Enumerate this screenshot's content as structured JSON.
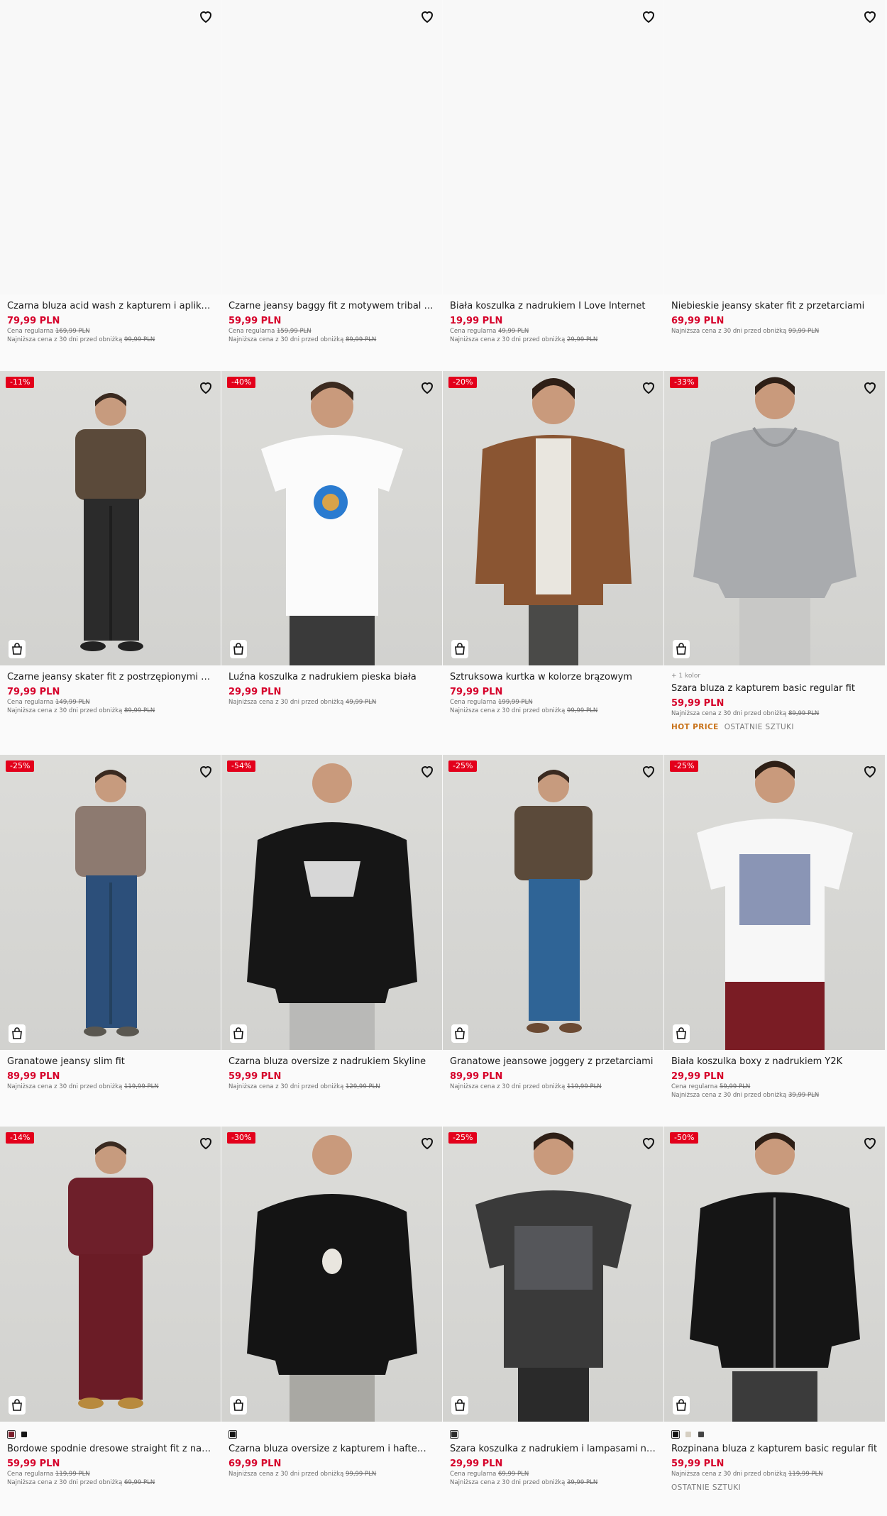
{
  "labels": {
    "regular": "Cena regularna",
    "lowest": "Najniższa cena z 30 dni przed obniżką"
  },
  "colors": {
    "price": "#d6002a",
    "badge": "#e3001b",
    "hot": "#c8721a"
  },
  "products": [
    {
      "title": "Czarna bluza acid wash z kapturem i aplikacjami",
      "price": "79,99 PLN",
      "regular": "169,99 PLN",
      "lowest": "99,99 PLN"
    },
    {
      "title": "Czarne jeansy baggy fit z motywem tribal na nogawkach",
      "price": "59,99 PLN",
      "regular": "159,99 PLN",
      "lowest": "89,99 PLN"
    },
    {
      "title": "Biała koszulka z nadrukiem I Love Internet",
      "price": "19,99 PLN",
      "regular": "49,99 PLN",
      "lowest": "29,99 PLN"
    },
    {
      "title": "Niebieskie jeansy skater fit z przetarciami",
      "price": "69,99 PLN",
      "lowest": "99,99 PLN"
    },
    {
      "badge": "-11%",
      "title": "Czarne jeansy skater fit z postrzępionymi brzegami",
      "price": "79,99 PLN",
      "regular": "149,99 PLN",
      "lowest": "89,99 PLN"
    },
    {
      "badge": "-40%",
      "title": "Luźna koszulka z nadrukiem pieska biała",
      "price": "29,99 PLN",
      "lowest": "49,99 PLN"
    },
    {
      "badge": "-20%",
      "title": "Sztruksowa kurtka w kolorze brązowym",
      "price": "79,99 PLN",
      "regular": "199,99 PLN",
      "lowest": "99,99 PLN"
    },
    {
      "badge": "-33%",
      "colors_count": "+ 1 kolor",
      "title": "Szara bluza z kapturem basic regular fit",
      "price": "59,99 PLN",
      "lowest": "89,99 PLN",
      "hot": "HOT PRICE",
      "last": "OSTATNIE SZTUKI"
    },
    {
      "badge": "-25%",
      "title": "Granatowe jeansy slim fit",
      "price": "89,99 PLN",
      "lowest": "119,99 PLN"
    },
    {
      "badge": "-54%",
      "title": "Czarna bluza oversize z nadrukiem Skyline",
      "price": "59,99 PLN",
      "lowest": "129,99 PLN"
    },
    {
      "badge": "-25%",
      "title": "Granatowe jeansowe joggery z przetarciami",
      "price": "89,99 PLN",
      "lowest": "119,99 PLN"
    },
    {
      "badge": "-25%",
      "title": "Biała koszulka boxy z nadrukiem Y2K",
      "price": "29,99 PLN",
      "regular": "59,99 PLN",
      "lowest": "39,99 PLN"
    },
    {
      "badge": "-14%",
      "title": "Bordowe spodnie dresowe straight fit z nadrukiem",
      "price": "59,99 PLN",
      "regular": "119,99 PLN",
      "lowest": "69,99 PLN"
    },
    {
      "badge": "-30%",
      "title": "Czarna bluza oversize z kapturem i haftem kaczki",
      "price": "69,99 PLN",
      "lowest": "99,99 PLN"
    },
    {
      "badge": "-25%",
      "title": "Szara koszulka z nadrukiem i lampasami na rękawach",
      "price": "29,99 PLN",
      "regular": "69,99 PLN",
      "lowest": "39,99 PLN"
    },
    {
      "badge": "-50%",
      "title": "Rozpinana bluza z kapturem basic regular fit",
      "price": "59,99 PLN",
      "lowest": "119,99 PLN",
      "last": "OSTATNIE SZTUKI"
    }
  ]
}
